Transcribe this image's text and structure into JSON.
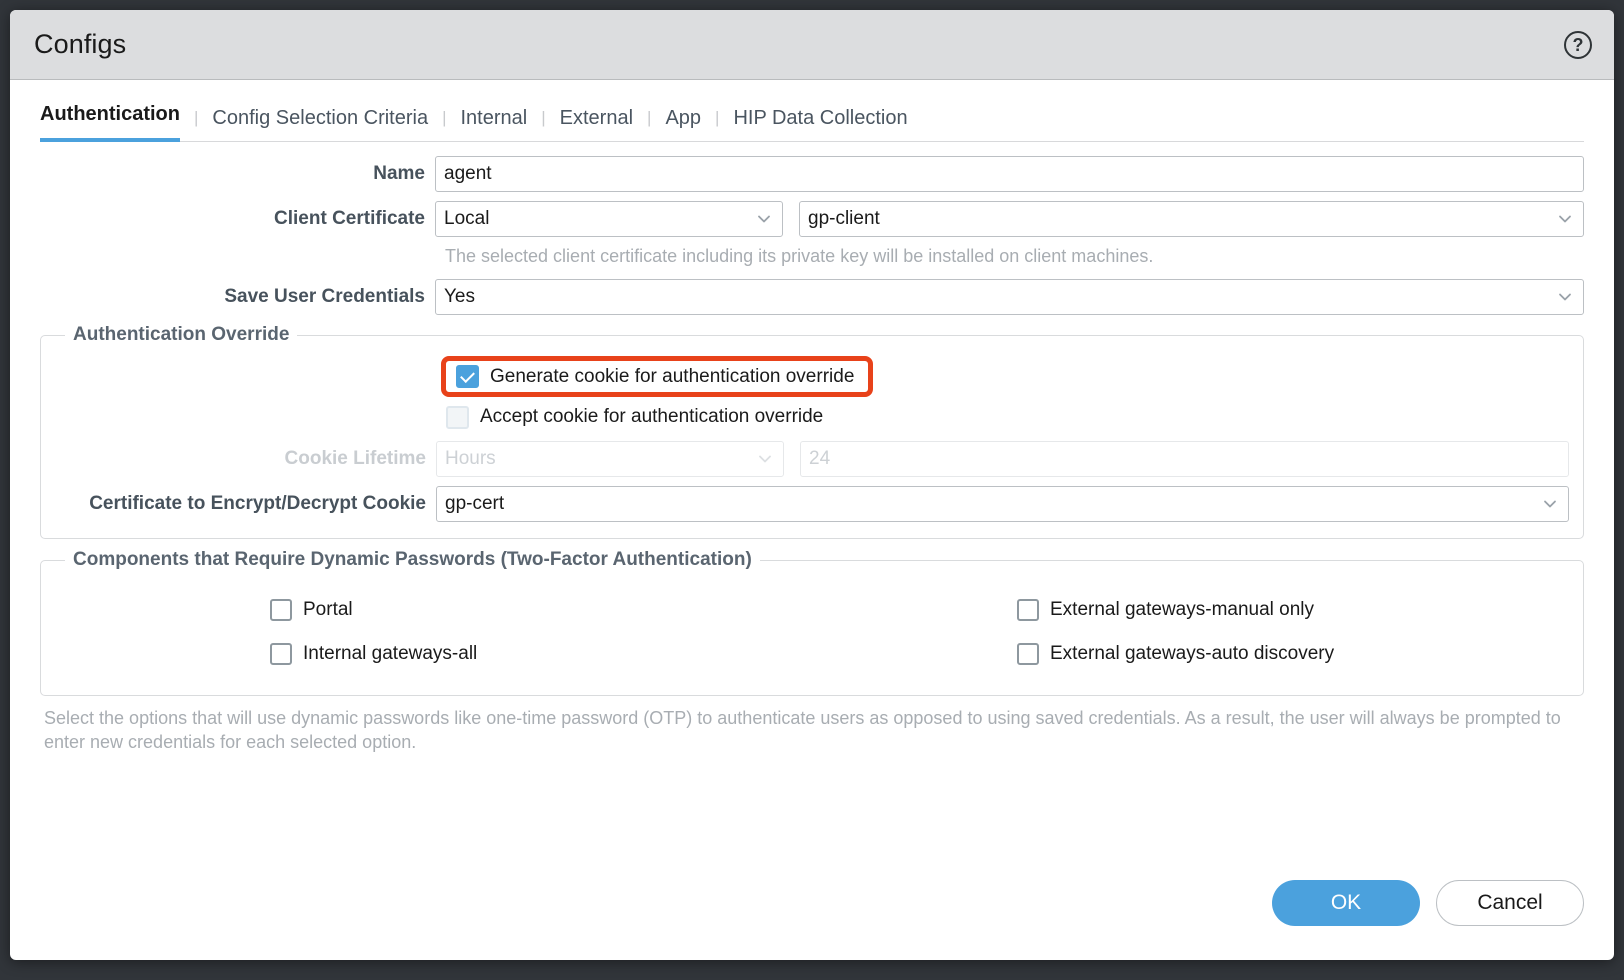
{
  "window": {
    "title": "Configs",
    "help_icon": "question-circle-icon"
  },
  "tabs": [
    {
      "label": "Authentication",
      "active": true
    },
    {
      "label": "Config Selection Criteria",
      "active": false
    },
    {
      "label": "Internal",
      "active": false
    },
    {
      "label": "External",
      "active": false
    },
    {
      "label": "App",
      "active": false
    },
    {
      "label": "HIP Data Collection",
      "active": false
    }
  ],
  "form": {
    "name": {
      "label": "Name",
      "value": "agent"
    },
    "client_certificate": {
      "label": "Client Certificate",
      "location_value": "Local",
      "cert_value": "gp-client",
      "helper": "The selected client certificate including its private key will be installed on client machines."
    },
    "save_user_credentials": {
      "label": "Save User Credentials",
      "value": "Yes"
    }
  },
  "authentication_override": {
    "legend": "Authentication Override",
    "generate_cookie": {
      "label": "Generate cookie for authentication override",
      "checked": true,
      "highlighted": true
    },
    "accept_cookie": {
      "label": "Accept cookie for authentication override",
      "checked": false
    },
    "cookie_lifetime": {
      "label": "Cookie Lifetime",
      "unit_placeholder": "Hours",
      "value_placeholder": "24",
      "disabled": true
    },
    "encrypt_cert": {
      "label": "Certificate to Encrypt/Decrypt Cookie",
      "value": "gp-cert"
    }
  },
  "two_factor": {
    "legend": "Components that Require Dynamic Passwords (Two-Factor Authentication)",
    "options": [
      {
        "label": "Portal",
        "checked": false
      },
      {
        "label": "External gateways-manual only",
        "checked": false
      },
      {
        "label": "Internal gateways-all",
        "checked": false
      },
      {
        "label": "External gateways-auto discovery",
        "checked": false
      }
    ],
    "note": "Select the options that will use dynamic passwords like one-time password (OTP) to authenticate users as opposed to using saved credentials. As a result, the user will always be prompted to enter new credentials for each selected option."
  },
  "actions": {
    "ok_label": "OK",
    "cancel_label": "Cancel"
  },
  "colors": {
    "accent": "#4ba1dd",
    "highlight": "#e8421a",
    "titlebar": "#dcdddf",
    "label_text": "#47525c",
    "muted_text": "#a8adb2"
  }
}
